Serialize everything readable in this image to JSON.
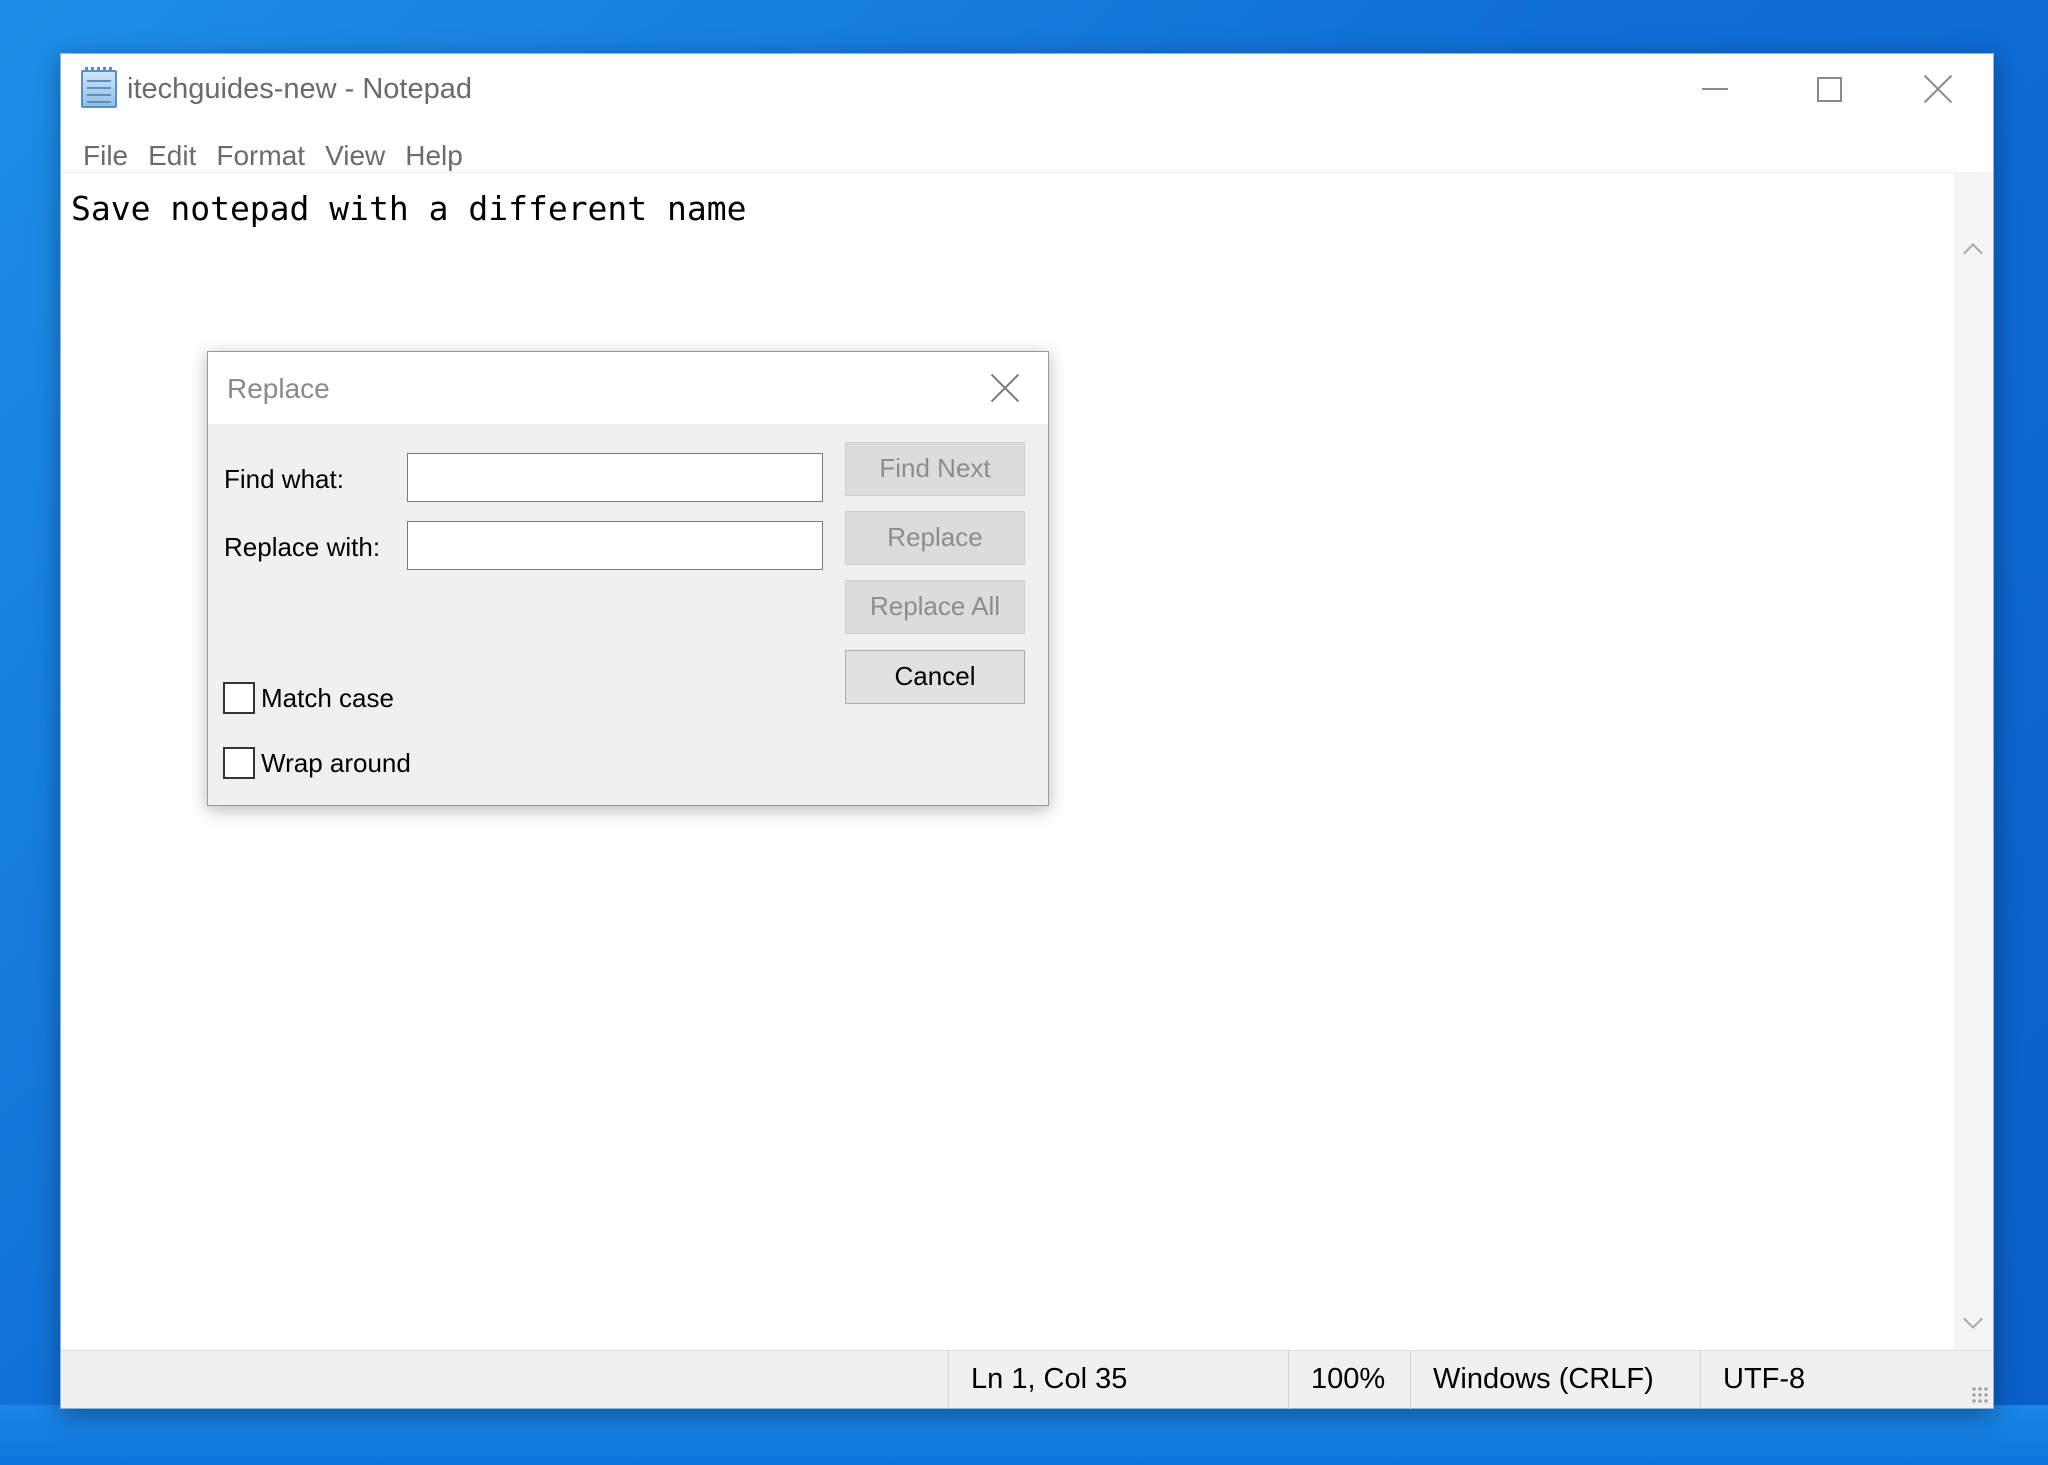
{
  "window": {
    "title": "itechguides-new - Notepad"
  },
  "menu": {
    "items": [
      "File",
      "Edit",
      "Format",
      "View",
      "Help"
    ]
  },
  "editor": {
    "content": "Save notepad with a different name"
  },
  "status": {
    "position": "Ln 1, Col 35",
    "zoom": "100%",
    "line_ending": "Windows (CRLF)",
    "encoding": "UTF-8"
  },
  "dialog": {
    "title": "Replace",
    "find_label": "Find what:",
    "replace_label": "Replace with:",
    "find_value": "",
    "replace_value": "",
    "buttons": {
      "find_next": "Find Next",
      "replace": "Replace",
      "replace_all": "Replace All",
      "cancel": "Cancel"
    },
    "options": {
      "match_case": "Match case",
      "wrap_around": "Wrap around"
    }
  },
  "icons": {
    "app": "notepad-icon",
    "minimize": "minimize-icon",
    "maximize": "maximize-icon",
    "close": "close-icon",
    "dialog_close": "close-icon",
    "scroll_up": "chevron-up-icon",
    "scroll_down": "chevron-down-icon",
    "grip": "resize-grip-icon"
  },
  "colors": {
    "desktop": "#0f6fd6",
    "dialog_bg": "#f0f0f0",
    "disabled_text": "#8d8d8d"
  }
}
